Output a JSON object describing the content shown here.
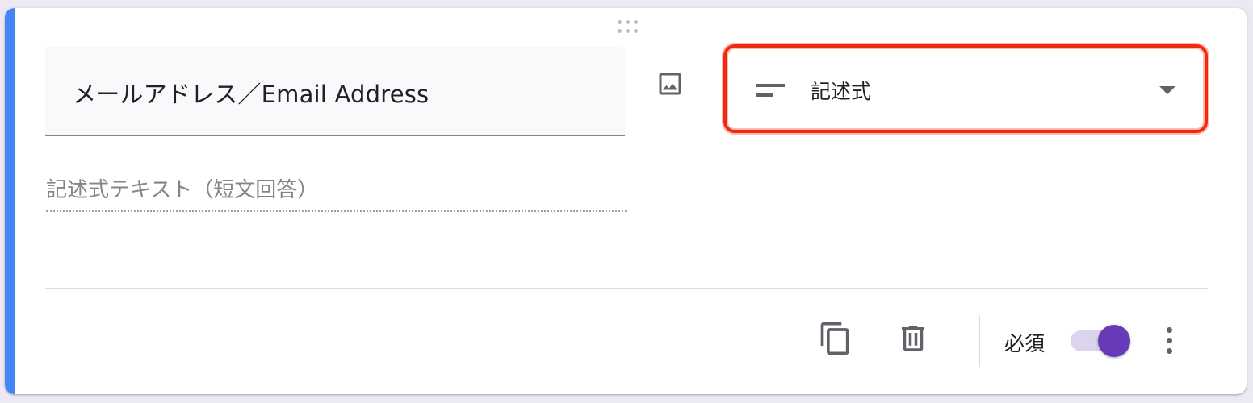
{
  "question": {
    "title": "メールアドレス／Email Address",
    "answer_hint": "記述式テキスト（短文回答）"
  },
  "type_select": {
    "label": "記述式",
    "icon": "short-answer-icon"
  },
  "footer": {
    "required_label": "必須",
    "required_on": true
  },
  "icons": {
    "drag": "drag-handle-icon",
    "image": "image-icon",
    "copy": "copy-icon",
    "delete": "trash-icon",
    "more": "more-vert-icon",
    "caret": "caret-down-icon"
  },
  "colors": {
    "accent": "#4285f4",
    "toggle_on": "#673ab7",
    "highlight": "#f02a10"
  }
}
